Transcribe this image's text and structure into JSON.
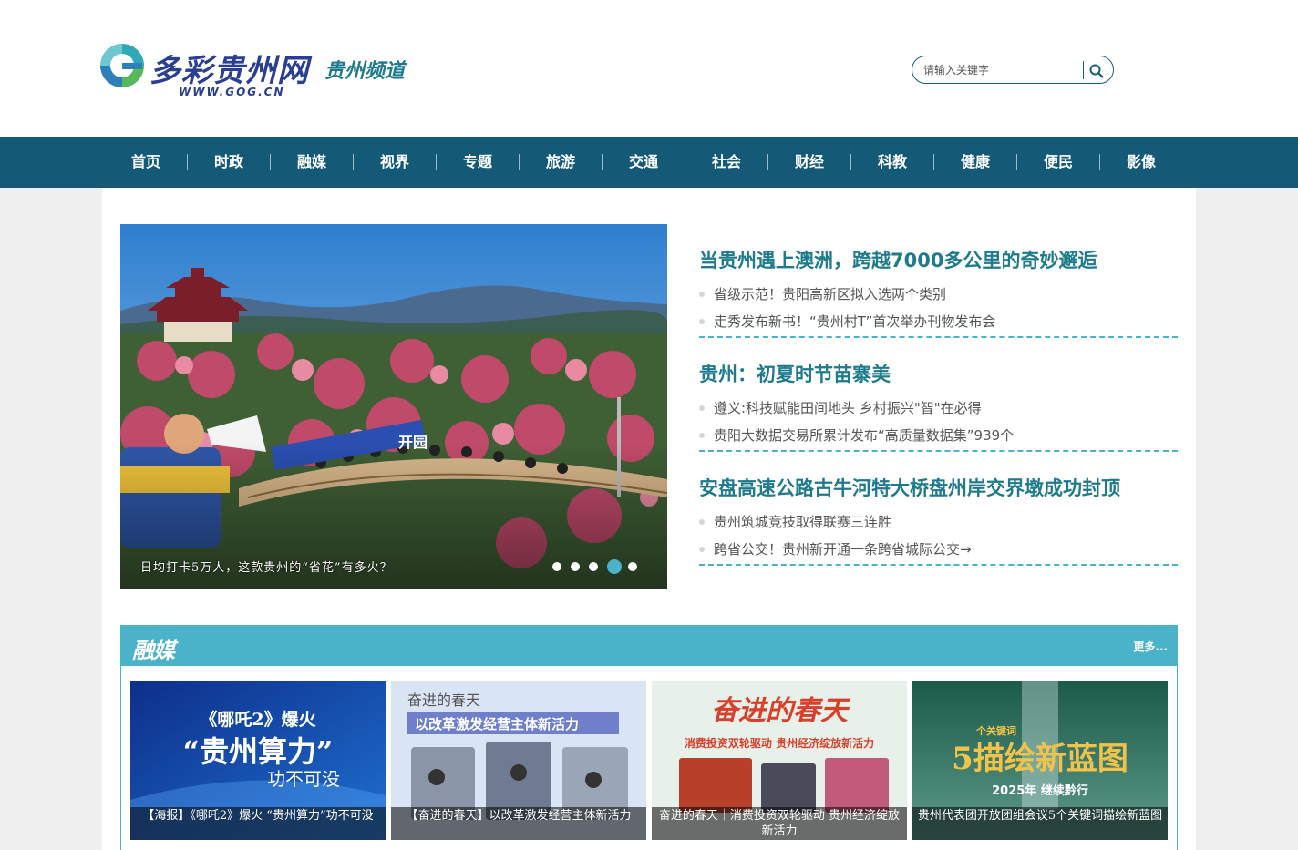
{
  "brand": {
    "logo_letter": "G",
    "logo_script": "多彩贵州网",
    "logo_url": "WWW.GOG.CN",
    "channel": "贵州频道",
    "colors": {
      "nav": "#145a76",
      "accent": "#4ab3c9",
      "headline": "#1e7b8c"
    }
  },
  "search": {
    "placeholder": "请输入关键字",
    "icon": "search-icon"
  },
  "nav": {
    "items": [
      {
        "label": "首页"
      },
      {
        "label": "时政"
      },
      {
        "label": "融媒"
      },
      {
        "label": "视界"
      },
      {
        "label": "专题"
      },
      {
        "label": "旅游"
      },
      {
        "label": "交通"
      },
      {
        "label": "社会"
      },
      {
        "label": "财经"
      },
      {
        "label": "科教"
      },
      {
        "label": "健康"
      },
      {
        "label": "便民"
      },
      {
        "label": "影像"
      }
    ]
  },
  "slider": {
    "caption": "日均打卡5万人，这款贵州的“省花”有多火？",
    "total": 5,
    "active_index": 3,
    "sign_text": "开园"
  },
  "headlines": [
    {
      "title": "当贵州遇上澳洲，跨越7000多公里的奇妙邂逅",
      "items": [
        "省级示范！贵阳高新区拟入选两个类别",
        "走秀发布新书！“贵州村T”首次举办刊物发布会"
      ]
    },
    {
      "title": "贵州：初夏时节苗寨美",
      "items": [
        "遵义:科技赋能田间地头 乡村振兴\"智\"在必得",
        "贵阳大数据交易所累计发布“高质量数据集”939个"
      ]
    },
    {
      "title": "安盘高速公路古牛河特大桥盘州岸交界墩成功封顶",
      "items": [
        "贵州筑城竞技取得联赛三连胜",
        "跨省公交！贵州新开通一条跨省城际公交→"
      ]
    }
  ],
  "media": {
    "title": "融媒",
    "more": "更多...",
    "cards": [
      {
        "art_line1": "《哪吒2》爆火",
        "art_line2": "“贵州算力”",
        "art_line3": "功不可没",
        "caption": "【海报】《哪吒2》爆火 “贵州算力”功不可没"
      },
      {
        "art_line1": "奋进的春天",
        "art_line2": "以改革激发经营主体新活力",
        "caption": "【奋进的春天】以改革激发经营主体新活力"
      },
      {
        "art_line1": "奋进的春天",
        "art_line2": "消费投资双轮驱动 贵州经济绽放新活力",
        "caption": "奋进的春天｜消费投资双轮驱动 贵州经济绽放新活力"
      },
      {
        "art_line1": "5描绘新蓝图",
        "art_small": "个关键词",
        "art_line2": "2025年 继续黔行",
        "caption": "贵州代表团开放团组会议5个关键词描绘新蓝图"
      }
    ]
  }
}
